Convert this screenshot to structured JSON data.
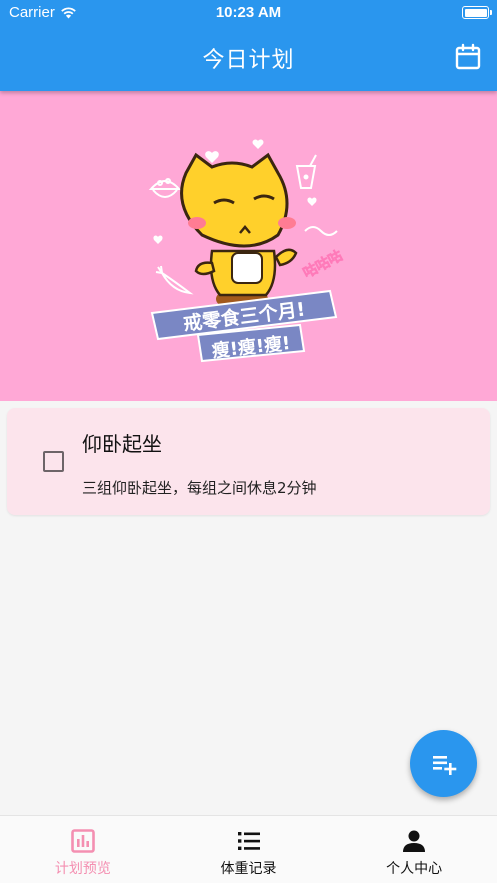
{
  "status_bar": {
    "carrier": "Carrier",
    "time": "10:23 AM"
  },
  "app_bar": {
    "title": "今日计划",
    "action_icon": "calendar-icon"
  },
  "banner": {
    "line1": "戒零食三个月!",
    "line2": "瘦!瘦!瘦!",
    "sticker_text": "咕咕咕"
  },
  "plans": [
    {
      "title": "仰卧起坐",
      "description": "三组仰卧起坐，每组之间休息2分钟",
      "checked": false
    }
  ],
  "fab": {
    "icon": "playlist-add-icon"
  },
  "bottom_nav": {
    "items": [
      {
        "label": "计划预览",
        "icon": "bar-chart-icon",
        "active": true
      },
      {
        "label": "体重记录",
        "icon": "list-icon",
        "active": false
      },
      {
        "label": "个人中心",
        "icon": "person-icon",
        "active": false
      }
    ]
  },
  "colors": {
    "primary": "#2a96ee",
    "banner_bg": "#ffa8d6",
    "card_bg": "#fce4ec",
    "nav_active": "#f48fb1"
  }
}
